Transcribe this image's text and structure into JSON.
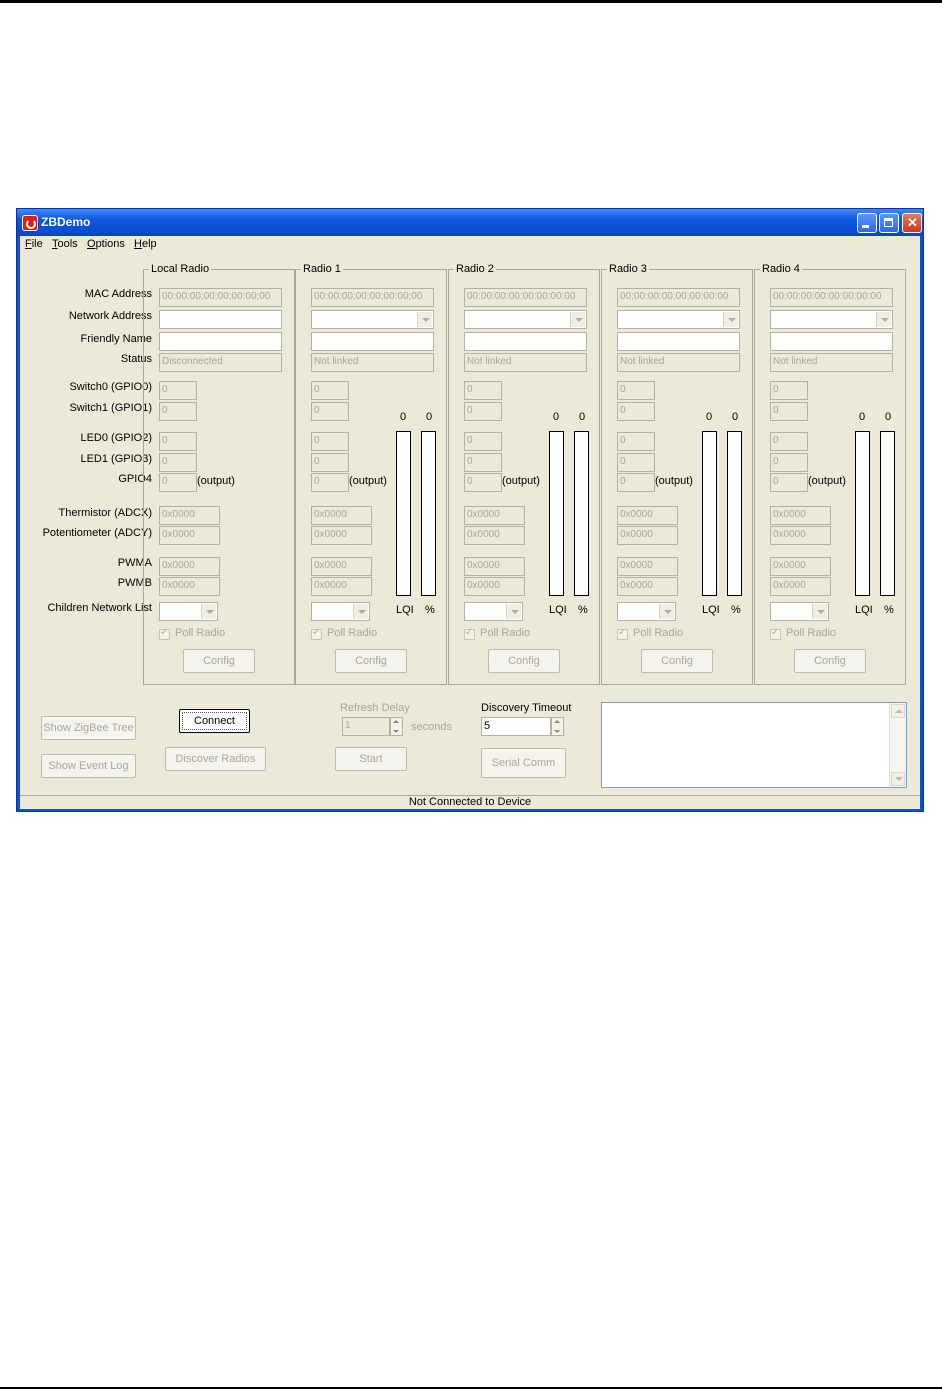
{
  "window": {
    "title": "ZBDemo"
  },
  "menu": [
    "File",
    "Tools",
    "Options",
    "Help"
  ],
  "row_labels": {
    "mac": "MAC Address",
    "net": "Network Address",
    "friendly": "Friendly Name",
    "status": "Status",
    "sw0": "Switch0 (GPIO0)",
    "sw1": "Switch1 (GPIO1)",
    "led0": "LED0 (GPIO2)",
    "led1": "LED1 (GPIO3)",
    "gpio4": "GPIO4",
    "therm": "Thermistor (ADCX)",
    "pot": "Potentiometer (ADCY)",
    "pwma": "PWMA",
    "pwmb": "PWMB",
    "children": "Children Network List"
  },
  "output_label": "(output)",
  "poll_label": "Poll Radio",
  "config_label": "Config",
  "lqi_label": "LQI",
  "pct_label": "%",
  "radios": [
    {
      "title": "Local Radio",
      "mac": "00:00:00:00:00:00:00:00",
      "status": "Disconnected",
      "sw0": "0",
      "sw1": "0",
      "led0": "0",
      "led1": "0",
      "gpio4": "0",
      "therm": "0x0000",
      "pot": "0x0000",
      "pwma": "0x0000",
      "pwmb": "0x0000"
    },
    {
      "title": "Radio 1",
      "mac": "00:00:00:00:00:00:00:00",
      "status": "Not linked",
      "sw0": "0",
      "sw1": "0",
      "led0": "0",
      "led1": "0",
      "gpio4": "0",
      "therm": "0x0000",
      "pot": "0x0000",
      "pwma": "0x0000",
      "pwmb": "0x0000",
      "lqi": "0",
      "pct": "0"
    },
    {
      "title": "Radio 2",
      "mac": "00:00:00:00:00:00:00:00",
      "status": "Not linked",
      "sw0": "0",
      "sw1": "0",
      "led0": "0",
      "led1": "0",
      "gpio4": "0",
      "therm": "0x0000",
      "pot": "0x0000",
      "pwma": "0x0000",
      "pwmb": "0x0000",
      "lqi": "0",
      "pct": "0"
    },
    {
      "title": "Radio 3",
      "mac": "00:00:00:00:00:00:00:00",
      "status": "Not linked",
      "sw0": "0",
      "sw1": "0",
      "led0": "0",
      "led1": "0",
      "gpio4": "0",
      "therm": "0x0000",
      "pot": "0x0000",
      "pwma": "0x0000",
      "pwmb": "0x0000",
      "lqi": "0",
      "pct": "0"
    },
    {
      "title": "Radio 4",
      "mac": "00:00:00:00:00:00:00:00",
      "status": "Not linked",
      "sw0": "0",
      "sw1": "0",
      "led0": "0",
      "led1": "0",
      "gpio4": "0",
      "therm": "0x0000",
      "pot": "0x0000",
      "pwma": "0x0000",
      "pwmb": "0x0000",
      "lqi": "0",
      "pct": "0"
    }
  ],
  "bottom": {
    "show_tree": "Show ZigBee Tree",
    "show_log": "Show  Event Log",
    "connect": "Connect",
    "discover": "Discover Radios",
    "refresh_label": "Refresh Delay",
    "refresh_value": "1",
    "seconds": "seconds",
    "start": "Start",
    "discovery_label": "Discovery Timeout",
    "discovery_value": "5",
    "serial": "Serial Comm"
  },
  "status": "Not Connected to Device"
}
